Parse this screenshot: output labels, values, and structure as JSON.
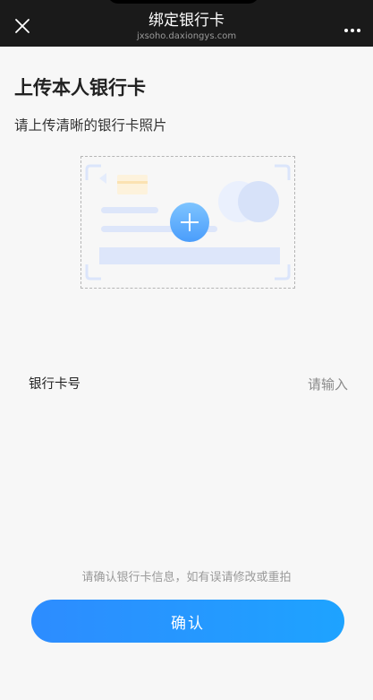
{
  "header": {
    "title": "绑定银行卡",
    "subtitle": "jxsoho.daxiongys.com"
  },
  "page": {
    "title": "上传本人银行卡",
    "subtitle": "请上传清晰的银行卡照片"
  },
  "upload": {
    "icon": "plus-icon"
  },
  "form": {
    "card_number_label": "银行卡号",
    "card_number_placeholder": "请输入",
    "card_number_value": ""
  },
  "notice": "请确认银行卡信息，如有误请修改或重拍",
  "confirm_label": "确认",
  "colors": {
    "header_bg": "#1a1a1a",
    "page_bg": "#f7f7f7",
    "accent": "#2d8cff"
  }
}
